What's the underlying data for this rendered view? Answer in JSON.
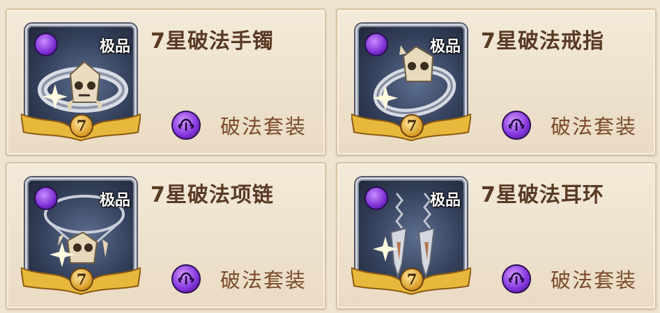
{
  "items": [
    {
      "grade": "极品",
      "name": "7星破法手镯",
      "stars": "7",
      "set": "破法套装",
      "icon": "bracelet-icon"
    },
    {
      "grade": "极品",
      "name": "7星破法戒指",
      "stars": "7",
      "set": "破法套装",
      "icon": "ring-icon"
    },
    {
      "grade": "极品",
      "name": "7星破法项链",
      "stars": "7",
      "set": "破法套装",
      "icon": "necklace-icon"
    },
    {
      "grade": "极品",
      "name": "7星破法耳环",
      "stars": "7",
      "set": "破法套装",
      "icon": "earrings-icon"
    }
  ],
  "colors": {
    "background": "#efe4d2",
    "name_text": "#5a3a24",
    "set_text": "#7a4b2c",
    "set_icon": "#8233dc",
    "star_badge": "#d89a22"
  }
}
